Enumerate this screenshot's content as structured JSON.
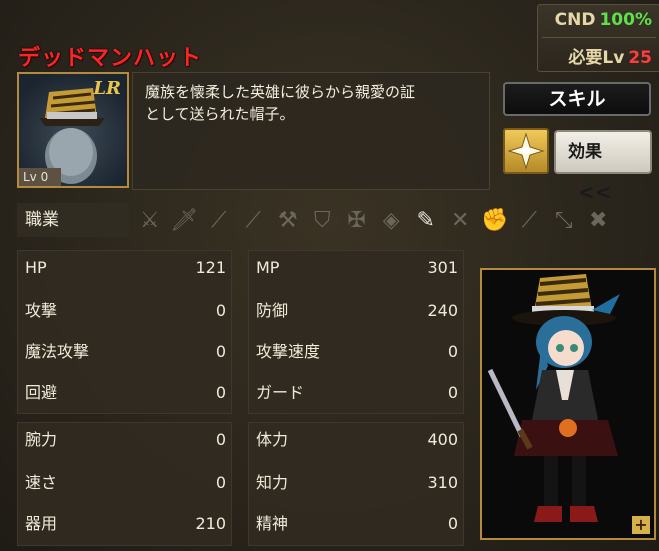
{
  "status": {
    "cnd_label": "CND",
    "cnd_value": "100%",
    "req_label": "必要Lv",
    "req_value": "25"
  },
  "item": {
    "name": "デッドマンハット",
    "rarity": "LR",
    "level": "Lv 0",
    "description_line1": "魔族を懐柔した英雄に彼らから親愛の証",
    "description_line2": "として送られた帽子。"
  },
  "buttons": {
    "skill": "スキル",
    "effect": "効果",
    "effect_chevron": "<<"
  },
  "job": {
    "label": "職業",
    "weapon_icons": [
      "sword-icon",
      "dagger-icon",
      "spear-icon",
      "staff-icon",
      "axe-icon",
      "shield-icon",
      "bow-icon",
      "katana-icon",
      "rod-icon",
      "gun-icon",
      "fist-icon",
      "hammer-icon",
      "whip-icon",
      "claw-icon"
    ]
  },
  "stats_group1": [
    {
      "left_key": "HP",
      "left_val": "121",
      "right_key": "MP",
      "right_val": "301"
    },
    {
      "left_key": "攻撃",
      "left_val": "0",
      "right_key": "防御",
      "right_val": "240"
    },
    {
      "left_key": "魔法攻撃",
      "left_val": "0",
      "right_key": "攻撃速度",
      "right_val": "0"
    },
    {
      "left_key": "回避",
      "left_val": "0",
      "right_key": "ガード",
      "right_val": "0"
    }
  ],
  "stats_group2": [
    {
      "left_key": "腕力",
      "left_val": "0",
      "right_key": "体力",
      "right_val": "400"
    },
    {
      "left_key": "速さ",
      "left_val": "0",
      "right_key": "知力",
      "right_val": "310"
    },
    {
      "left_key": "器用",
      "left_val": "210",
      "right_key": "精神",
      "right_val": "0"
    }
  ],
  "colors": {
    "title_red": "#ff2424",
    "cnd_green": "#5fe04a",
    "req_red": "#ff3b3b",
    "frame_gold": "#b48a3c"
  }
}
